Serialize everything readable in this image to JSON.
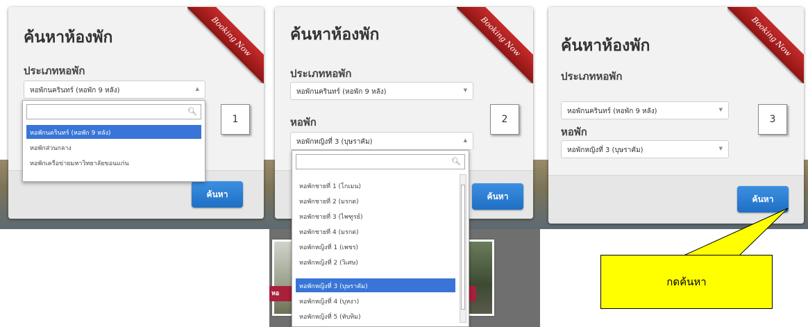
{
  "ribbon": "Booking Now",
  "search_card": {
    "title": "ค้นหาห้องพัก",
    "type_label": "ประเภทหอพัก",
    "type_selected": "หอพักนครินทร์ (หอพัก 9 หลัง)",
    "dorm_label": "หอพัก",
    "dorm_selected": "หอพักหญิงที่ 3 (บุษราคัม)",
    "search_button": "ค้นหา"
  },
  "steps": [
    "1",
    "2",
    "3"
  ],
  "type_options": [
    "หอพักนครินทร์ (หอพัก 9 หลัง)",
    "หอพักส่วนกลาง",
    "หอพักเครือข่ายมหาวิทยาลัยขอนแก่น"
  ],
  "dorm_options": [
    "หอพักชายที่ 1 (โกเมน)",
    "หอพักชายที่ 2 (มรกต)",
    "หอพักชายที่ 3 (ไพฑูรย์)",
    "หอพักชายที่ 4 (มรกต)",
    "หอพักหญิงที่ 1 (เพชร)",
    "หอพักหญิงที่ 2 (วิเศษ)",
    "หอพักหญิงที่ 3 (บุษราคัม)",
    "หอพักหญิงที่ 4 (บุหงา)",
    "หอพักหญิงที่ 5 (ทับทิม)"
  ],
  "photo_tags": [
    "หอ",
    "หอ",
    "หอ"
  ],
  "callout": "กดค้นหา",
  "colors": {
    "ribbon": "#b52222",
    "button": "#2a7fd4",
    "selection": "#3875d7",
    "callout": "#ffff00",
    "tag": "#a8203b"
  }
}
